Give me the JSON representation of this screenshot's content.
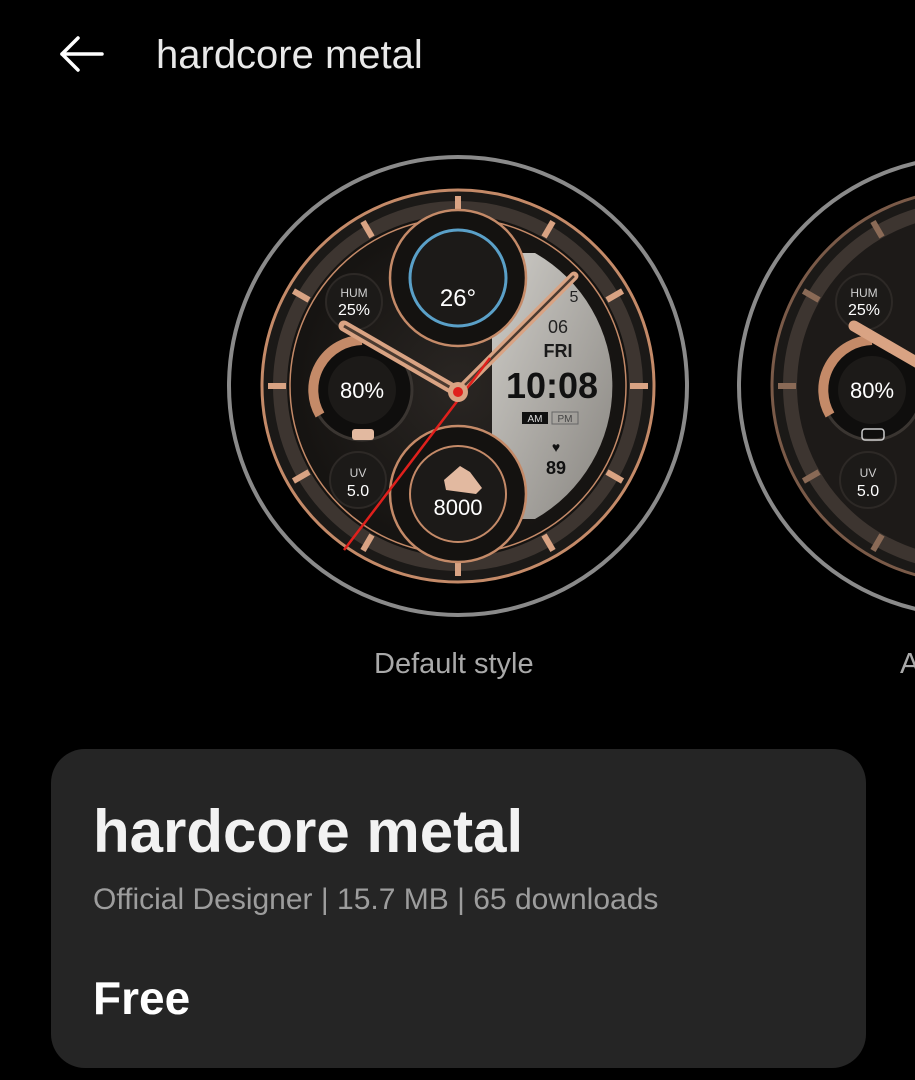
{
  "header": {
    "title": "hardcore metal",
    "back_icon": "arrow-left-icon"
  },
  "preview": {
    "styles": [
      {
        "label": "Default style",
        "selected": true
      },
      {
        "label": "A"
      }
    ],
    "watch": {
      "humidity_label": "HUM",
      "humidity_value": "25%",
      "temperature": "26°",
      "battery": "80%",
      "uv_label": "UV",
      "uv_value": "5.0",
      "steps": "8000",
      "date_top": "5",
      "date": "06",
      "weekday": "FRI",
      "time": "10:08",
      "am": "AM",
      "pm": "PM",
      "heart_rate": "89"
    }
  },
  "card": {
    "title": "hardcore metal",
    "designer": "Official Designer",
    "size": "15.7 MB",
    "downloads": "65 downloads",
    "price": "Free"
  },
  "colors": {
    "accent": "#d9a383",
    "background": "#000000",
    "card": "#252525",
    "second_hand": "#e0201c"
  }
}
